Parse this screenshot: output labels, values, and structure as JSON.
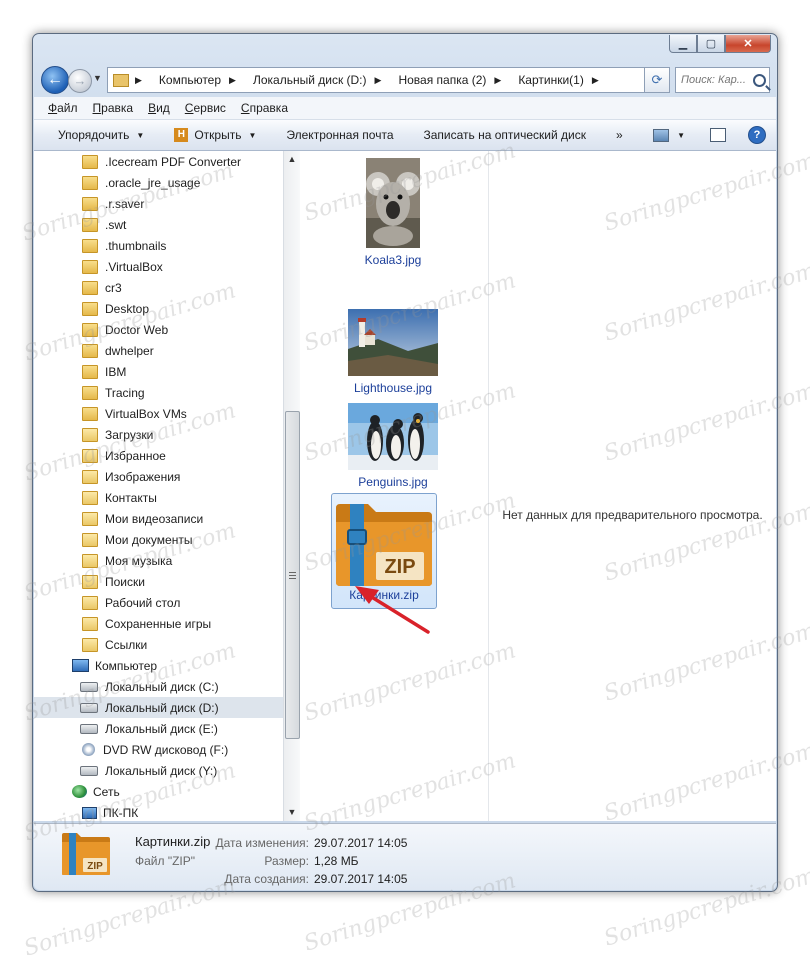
{
  "window": {
    "minimize_label": "▁",
    "maximize_label": "▢",
    "close_label": "✕"
  },
  "address": {
    "back_label": "←",
    "forward_label": "→",
    "crumbs": [
      "Компьютер",
      "Локальный диск (D:)",
      "Новая папка (2)",
      "Картинки(1)"
    ],
    "search_placeholder": "Поиск: Кар..."
  },
  "menu": {
    "items": [
      {
        "ul": "Ф",
        "rest": "айл"
      },
      {
        "ul": "П",
        "rest": "равка"
      },
      {
        "ul": "В",
        "rest": "ид"
      },
      {
        "ul": "С",
        "rest": "ервис"
      },
      {
        "ul": "С",
        "rest": "правка"
      }
    ]
  },
  "toolbar": {
    "organize": "Упорядочить",
    "open": "Открыть",
    "email": "Электронная почта",
    "burn": "Записать на оптический диск",
    "more": "»"
  },
  "tree": [
    {
      "label": ".Icecream PDF Converter",
      "icon": "folder"
    },
    {
      "label": ".oracle_jre_usage",
      "icon": "folder"
    },
    {
      "label": ".r.saver",
      "icon": "folder"
    },
    {
      "label": ".swt",
      "icon": "folder"
    },
    {
      "label": ".thumbnails",
      "icon": "folder"
    },
    {
      "label": ".VirtualBox",
      "icon": "folder"
    },
    {
      "label": "cr3",
      "icon": "folder"
    },
    {
      "label": "Desktop",
      "icon": "folder"
    },
    {
      "label": "Doctor Web",
      "icon": "folder"
    },
    {
      "label": "dwhelper",
      "icon": "folder"
    },
    {
      "label": "IBM",
      "icon": "folder"
    },
    {
      "label": "Tracing",
      "icon": "folder"
    },
    {
      "label": "VirtualBox VMs",
      "icon": "folder"
    },
    {
      "label": "Загрузки",
      "icon": "special"
    },
    {
      "label": "Избранное",
      "icon": "special"
    },
    {
      "label": "Изображения",
      "icon": "special"
    },
    {
      "label": "Контакты",
      "icon": "special"
    },
    {
      "label": "Мои видеозаписи",
      "icon": "special"
    },
    {
      "label": "Мои документы",
      "icon": "special"
    },
    {
      "label": "Моя музыка",
      "icon": "special"
    },
    {
      "label": "Поиски",
      "icon": "special"
    },
    {
      "label": "Рабочий стол",
      "icon": "special"
    },
    {
      "label": "Сохраненные игры",
      "icon": "special"
    },
    {
      "label": "Ссылки",
      "icon": "special"
    },
    {
      "label": "Компьютер",
      "icon": "computer"
    },
    {
      "label": "Локальный диск (C:)",
      "icon": "drive"
    },
    {
      "label": "Локальный диск (D:)",
      "icon": "drive",
      "selected": true
    },
    {
      "label": "Локальный диск (E:)",
      "icon": "drive"
    },
    {
      "label": "DVD RW дисковод (F:)",
      "icon": "dvd"
    },
    {
      "label": "Локальный диск (Y:)",
      "icon": "drive"
    },
    {
      "label": "Сеть",
      "icon": "network"
    },
    {
      "label": "ПК-ПК",
      "icon": "pc"
    }
  ],
  "files": [
    {
      "name": "Koala3.jpg"
    },
    {
      "name": "Lighthouse.jpg"
    },
    {
      "name": "Penguins.jpg"
    },
    {
      "name": "Картинки.zip",
      "badge": "ZIP",
      "selected": true
    }
  ],
  "preview": {
    "empty_text": "Нет данных для предварительного просмотра."
  },
  "details": {
    "name": "Картинки.zip",
    "type": "Файл \"ZIP\"",
    "badge": "ZIP",
    "rows": [
      {
        "k": "Дата изменения:",
        "v": "29.07.2017 14:05"
      },
      {
        "k": "Размер:",
        "v": "1,28 МБ"
      },
      {
        "k": "Дата создания:",
        "v": "29.07.2017 14:05"
      }
    ]
  },
  "watermark": "Soringpcrepair.com",
  "colors": {
    "zip_orange": "#e8962a",
    "zip_strap": "#2f82c0",
    "arrow_red": "#d9222a"
  }
}
